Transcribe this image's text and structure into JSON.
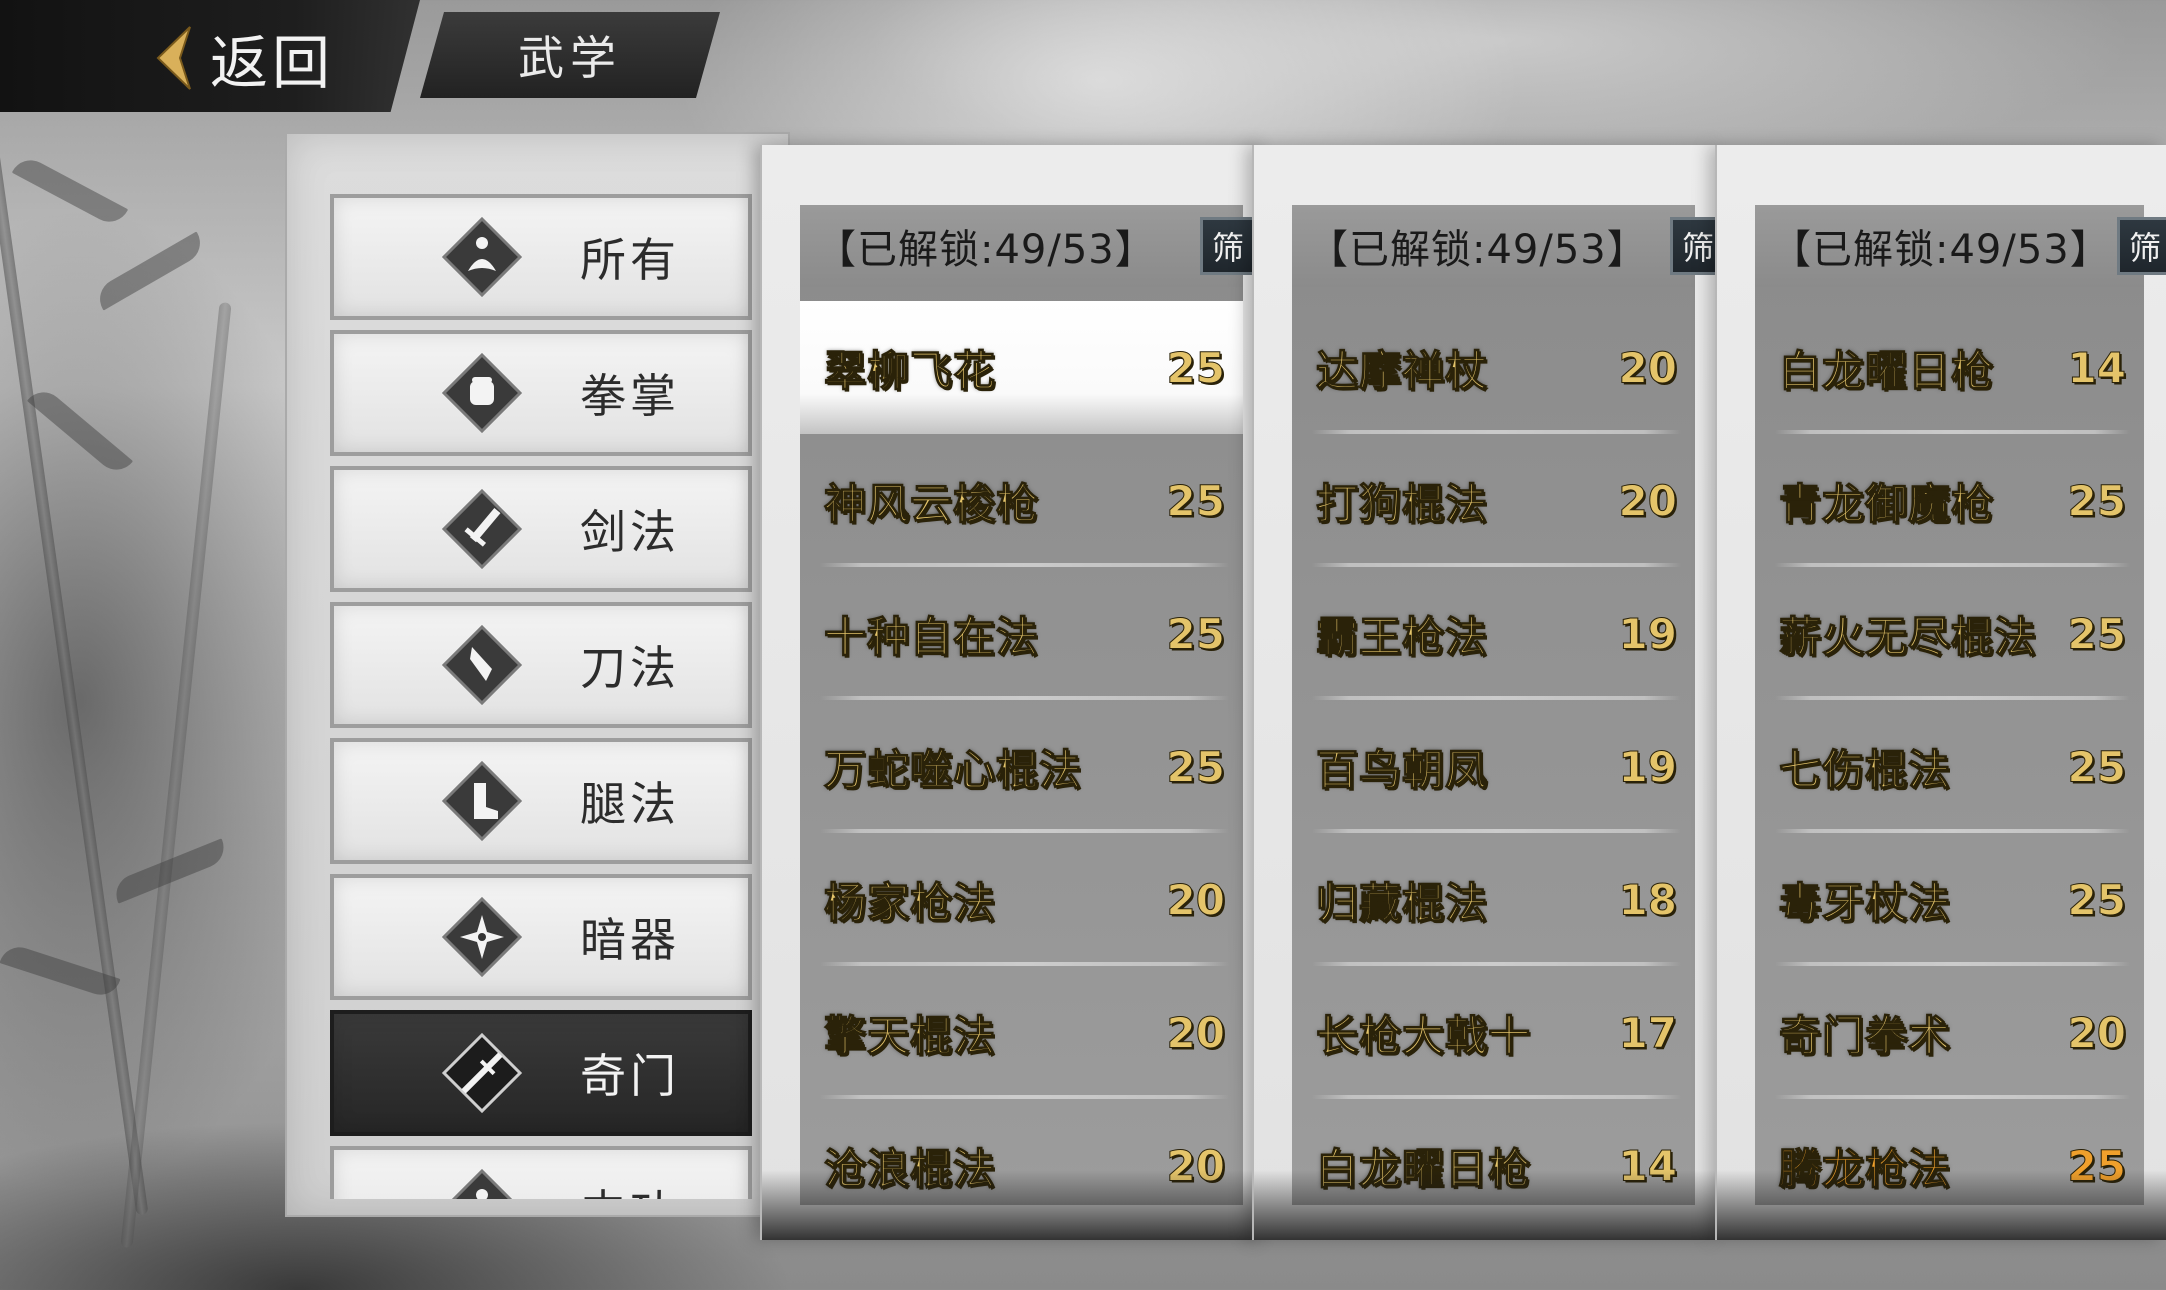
{
  "header": {
    "back_label": "返回",
    "title": "武学"
  },
  "categories": [
    {
      "label": "所有",
      "icon": "meditation-icon",
      "active": false
    },
    {
      "label": "拳掌",
      "icon": "fist-icon",
      "active": false
    },
    {
      "label": "剑法",
      "icon": "sword-icon",
      "active": false
    },
    {
      "label": "刀法",
      "icon": "blade-icon",
      "active": false
    },
    {
      "label": "腿法",
      "icon": "boot-icon",
      "active": false
    },
    {
      "label": "暗器",
      "icon": "shuriken-icon",
      "active": false
    },
    {
      "label": "奇门",
      "icon": "staff-icon",
      "active": true
    },
    {
      "label": "内功",
      "icon": "meditation-icon",
      "active": false
    }
  ],
  "columns": [
    {
      "unlock_text": "【已解锁:49/53】",
      "filter_label": "筛",
      "rows": [
        {
          "name": "翠柳飞花",
          "value": "25",
          "selected": true
        },
        {
          "name": "神风云梭枪",
          "value": "25"
        },
        {
          "name": "十种自在法",
          "value": "25"
        },
        {
          "name": "万蛇噬心棍法",
          "value": "25"
        },
        {
          "name": "杨家枪法",
          "value": "20"
        },
        {
          "name": "擎天棍法",
          "value": "20"
        },
        {
          "name": "沧浪棍法",
          "value": "20"
        }
      ]
    },
    {
      "unlock_text": "【已解锁:49/53】",
      "filter_label": "筛",
      "rows": [
        {
          "name": "达摩禅杖",
          "value": "20"
        },
        {
          "name": "打狗棍法",
          "value": "20"
        },
        {
          "name": "霸王枪法",
          "value": "19"
        },
        {
          "name": "百鸟朝凤",
          "value": "19"
        },
        {
          "name": "归藏棍法",
          "value": "18"
        },
        {
          "name": "长枪大戟十",
          "value": "17"
        },
        {
          "name": "白龙曜日枪",
          "value": "14"
        }
      ]
    },
    {
      "unlock_text": "【已解锁:49/53】",
      "filter_label": "筛",
      "rows": [
        {
          "name": "白龙曜日枪",
          "value": "14"
        },
        {
          "name": "青龙御魔枪",
          "value": "25"
        },
        {
          "name": "薪火无尽棍法",
          "value": "25"
        },
        {
          "name": "七伤棍法",
          "value": "25"
        },
        {
          "name": "毒牙杖法",
          "value": "25"
        },
        {
          "name": "奇门拳术",
          "value": "20"
        },
        {
          "name": "腾龙枪法",
          "value": "25",
          "orange": true
        }
      ]
    }
  ],
  "colors": {
    "gold_text": "#e4c46a",
    "orange_text": "#f0a02c",
    "active_category_bg": "#2e2e2e"
  }
}
